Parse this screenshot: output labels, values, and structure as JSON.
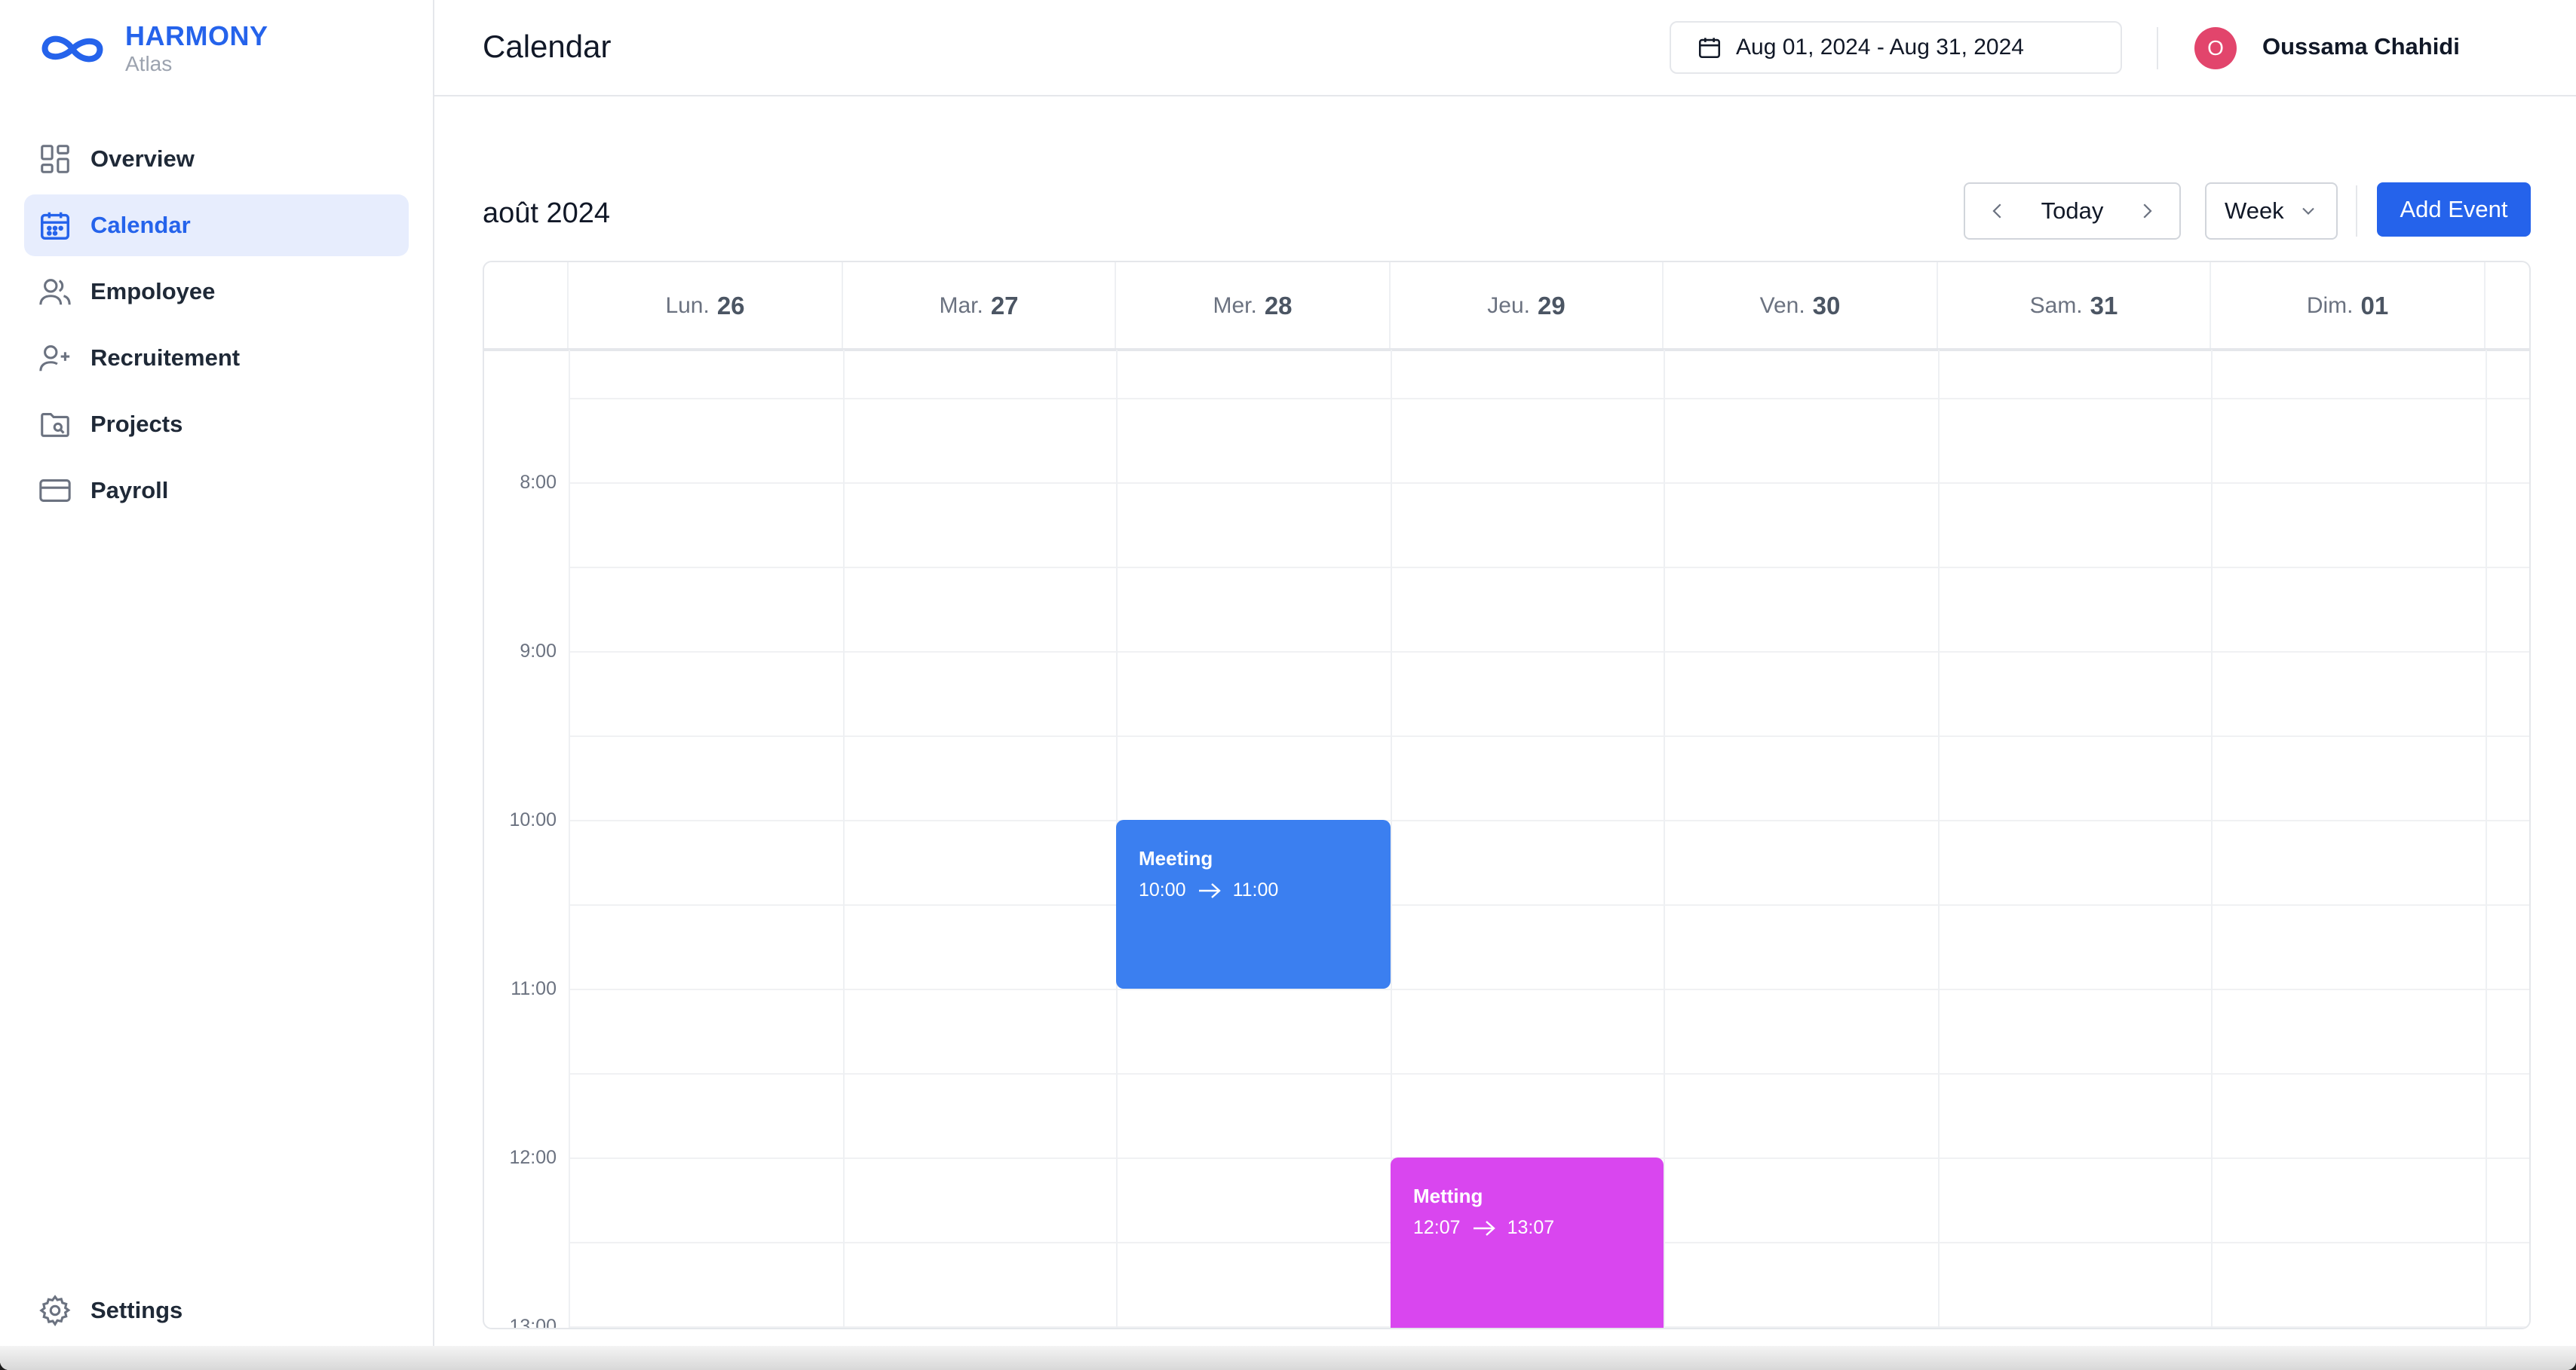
{
  "brand": {
    "name": "HARMONY",
    "subtitle": "Atlas"
  },
  "sidebar": {
    "items": [
      {
        "label": "Overview",
        "icon": "grid-icon",
        "active": false
      },
      {
        "label": "Calendar",
        "icon": "calendar-icon",
        "active": true
      },
      {
        "label": "Empoloyee",
        "icon": "users-icon",
        "active": false
      },
      {
        "label": "Recruitement",
        "icon": "user-plus-icon",
        "active": false
      },
      {
        "label": "Projects",
        "icon": "folder-icon",
        "active": false
      },
      {
        "label": "Payroll",
        "icon": "credit-card-icon",
        "active": false
      }
    ],
    "settings_label": "Settings"
  },
  "header": {
    "title": "Calendar",
    "date_range": "Aug 01, 2024 - Aug 31, 2024",
    "user_initial": "O",
    "user_name": "Oussama Chahidi"
  },
  "toolbar": {
    "month_label": "août 2024",
    "today_label": "Today",
    "view_label": "Week",
    "add_event_label": "Add Event"
  },
  "calendar": {
    "days": [
      {
        "name": "Lun.",
        "num": "26"
      },
      {
        "name": "Mar.",
        "num": "27"
      },
      {
        "name": "Mer.",
        "num": "28"
      },
      {
        "name": "Jeu.",
        "num": "29"
      },
      {
        "name": "Ven.",
        "num": "30"
      },
      {
        "name": "Sam.",
        "num": "31"
      },
      {
        "name": "Dim.",
        "num": "01"
      }
    ],
    "time_labels": [
      "8:00",
      "9:00",
      "10:00",
      "11:00",
      "12:00",
      "13:00"
    ],
    "events": [
      {
        "title": "Meeting",
        "start": "10:00",
        "end": "11:00",
        "day": "Mer. 28",
        "color": "#3b7ff0"
      },
      {
        "title": "Metting",
        "start": "12:07",
        "end": "13:07",
        "day": "Jeu. 29",
        "color": "#d946ef"
      }
    ]
  },
  "colors": {
    "accent": "#2563eb",
    "active_bg": "#e7edfd",
    "avatar": "#e2456c"
  }
}
